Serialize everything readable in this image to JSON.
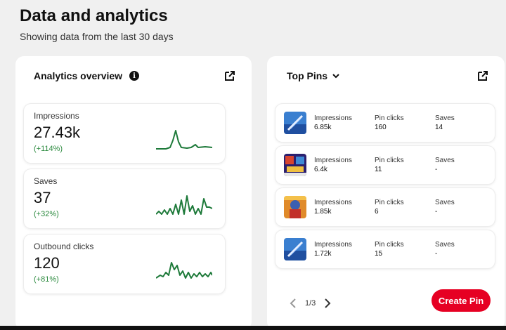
{
  "header": {
    "title": "Data and analytics",
    "subtitle": "Showing data from the last 30 days"
  },
  "overview": {
    "title": "Analytics overview",
    "info_icon": "info-icon",
    "external_icon": "external-link-icon",
    "metrics": [
      {
        "label": "Impressions",
        "value": "27.43k",
        "change": "(+114%)"
      },
      {
        "label": "Saves",
        "value": "37",
        "change": "(+32%)"
      },
      {
        "label": "Outbound clicks",
        "value": "120",
        "change": "(+81%)"
      }
    ],
    "trend_color": "#1e7a3a"
  },
  "top_pins": {
    "title": "Top Pins",
    "dropdown_icon": "chevron-down-icon",
    "external_icon": "external-link-icon",
    "pins": [
      {
        "thumb": "pin-thumbnail-blue",
        "impressions_label": "Impressions",
        "impressions": "6.85k",
        "clicks_label": "Pin clicks",
        "clicks": "160",
        "saves_label": "Saves",
        "saves": "14"
      },
      {
        "thumb": "pin-thumbnail-game",
        "impressions_label": "Impressions",
        "impressions": "6.4k",
        "clicks_label": "Pin clicks",
        "clicks": "11",
        "saves_label": "Saves",
        "saves": "-"
      },
      {
        "thumb": "pin-thumbnail-hero",
        "impressions_label": "Impressions",
        "impressions": "1.85k",
        "clicks_label": "Pin clicks",
        "clicks": "6",
        "saves_label": "Saves",
        "saves": "-"
      },
      {
        "thumb": "pin-thumbnail-blue",
        "impressions_label": "Impressions",
        "impressions": "1.72k",
        "clicks_label": "Pin clicks",
        "clicks": "15",
        "saves_label": "Saves",
        "saves": "-"
      }
    ],
    "pagination": {
      "label": "1/3",
      "prev_icon": "chevron-left-icon",
      "next_icon": "chevron-right-icon"
    },
    "create_button": "Create Pin",
    "accent": "#e60023"
  }
}
